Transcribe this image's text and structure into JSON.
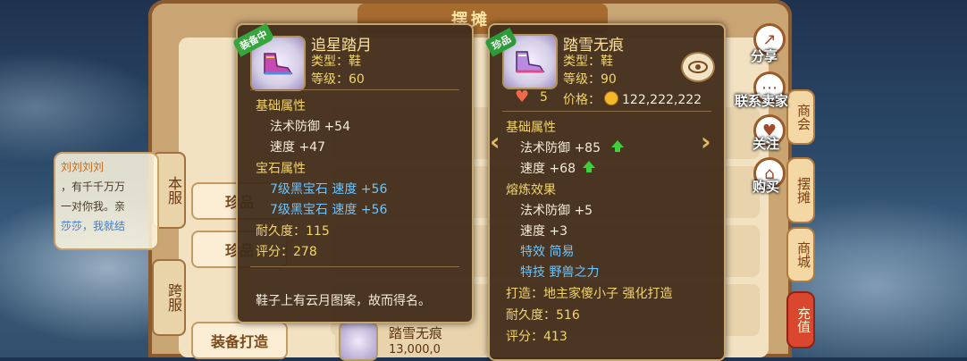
{
  "shop": {
    "title": "摆摊",
    "left_tabs": [
      "本服",
      "跨服"
    ],
    "left_buttons": [
      "珍品",
      "珍品",
      "装备打造"
    ],
    "right_tabs": [
      "商会",
      "摆摊",
      "商城",
      "充值"
    ],
    "bottom_item": {
      "name": "踏雪无痕",
      "price": "13,000,0"
    }
  },
  "chat": {
    "name": "刘刘刘刘",
    "lines": [
      "，有千千万万",
      "一对你我。亲",
      "莎莎，我就结"
    ]
  },
  "right_actions": [
    {
      "icon": "share-icon",
      "label": "分享"
    },
    {
      "icon": "contact-icon",
      "label": "联系卖家"
    },
    {
      "icon": "heart-icon",
      "label": "关注"
    },
    {
      "icon": "cart-icon",
      "label": "购买"
    }
  ],
  "card_left": {
    "badge": "装备中",
    "name": "追星踏月",
    "type": "类型：鞋",
    "level": "等级：60",
    "base_title": "基础属性",
    "base": [
      "法术防御 +54",
      "速度 +47"
    ],
    "gem_title": "宝石属性",
    "gems": [
      "7级黑宝石  速度 +56",
      "7级黑宝石  速度 +56"
    ],
    "durability": "耐久度：115",
    "score": "评分：278",
    "desc": "鞋子上有云月图案，故而得名。"
  },
  "card_right": {
    "badge": "珍品",
    "name": "踏雪无痕",
    "type": "类型：鞋",
    "level": "等级：90",
    "likes": "5",
    "price_label": "价格：",
    "price": "122,222,222",
    "base_title": "基础属性",
    "base": [
      "法术防御 +85",
      "速度 +68"
    ],
    "refine_title": "熔炼效果",
    "refine": [
      "法术防御 +5",
      "速度 +3"
    ],
    "special_effect": "特效  简易",
    "special_skill": "特技  野兽之力",
    "crafted": "打造：地主家傻小子   强化打造",
    "durability": "耐久度：516",
    "score": "评分：413"
  },
  "colors": {
    "card_bg": "#402c1a",
    "gold_text": "#f3d46a",
    "blue_text": "#6cc4ff",
    "up_arrow": "#3fcf3a"
  }
}
